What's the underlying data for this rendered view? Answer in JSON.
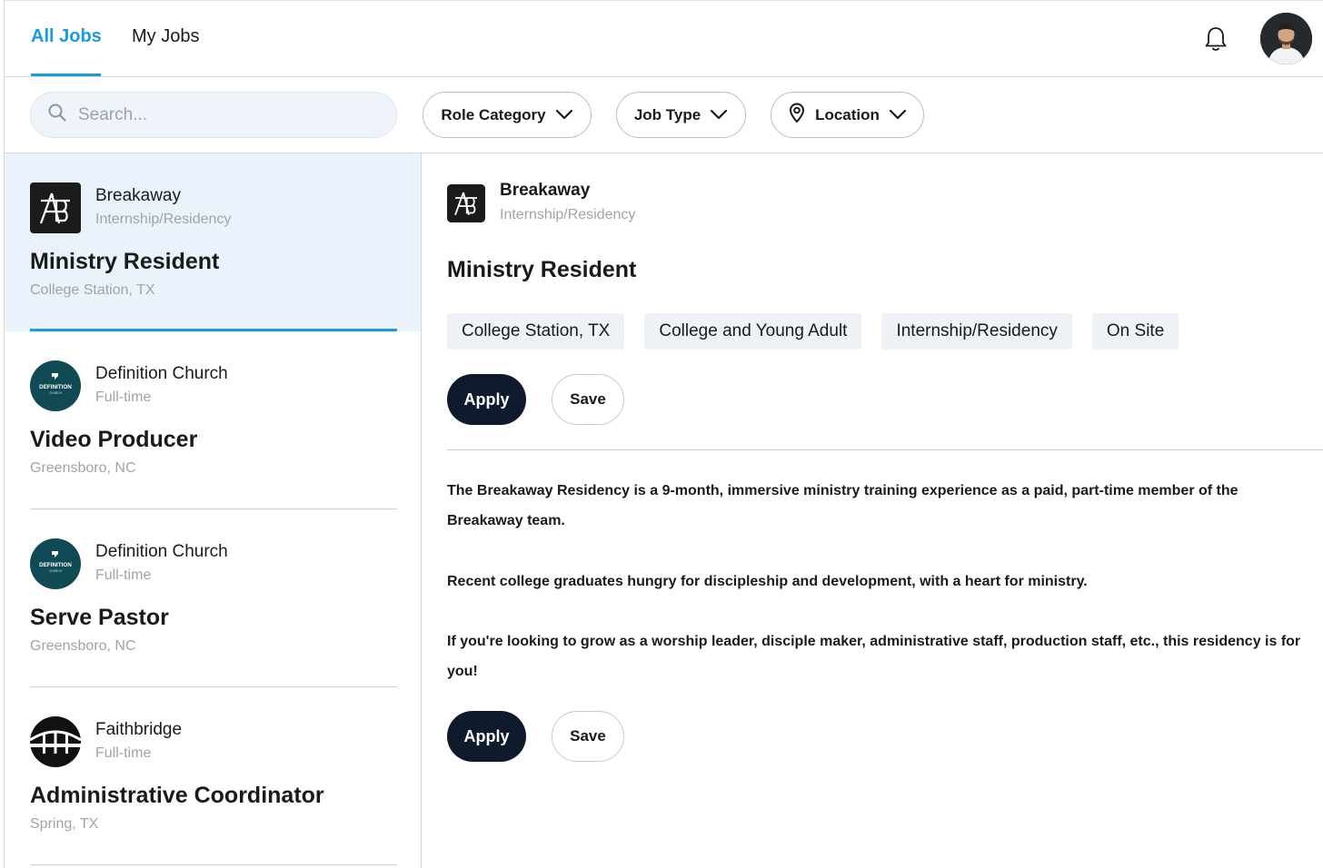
{
  "nav": {
    "tabs": [
      {
        "label": "All Jobs",
        "active": true
      },
      {
        "label": "My Jobs",
        "active": false
      }
    ],
    "accent_color": "#1a9be0"
  },
  "filters": {
    "search_placeholder": "Search...",
    "role_category": "Role Category",
    "job_type": "Job Type",
    "location": "Location"
  },
  "jobs": [
    {
      "org": "Breakaway",
      "kind": "Internship/Residency",
      "title": "Ministry Resident",
      "location": "College Station, TX",
      "selected": true,
      "logo": "breakaway-logo"
    },
    {
      "org": "Definition Church",
      "kind": "Full-time",
      "title": "Video Producer",
      "location": "Greensboro, NC",
      "logo": "definition-church-logo"
    },
    {
      "org": "Definition Church",
      "kind": "Full-time",
      "title": "Serve Pastor",
      "location": "Greensboro, NC",
      "logo": "definition-church-logo"
    },
    {
      "org": "Faithbridge",
      "kind": "Full-time",
      "title": "Administrative Coordinator",
      "location": "Spring, TX",
      "logo": "faithbridge-logo"
    }
  ],
  "detail": {
    "org": "Breakaway",
    "kind": "Internship/Residency",
    "title": "Ministry Resident",
    "tags": [
      "College Station, TX",
      "College and Young Adult",
      "Internship/Residency",
      "On Site"
    ],
    "apply_label": "Apply",
    "save_label": "Save",
    "description": [
      "The Breakaway Residency is a 9-month, immersive ministry training experience as a paid, part-time member of the Breakaway team.",
      "Recent college graduates hungry for discipleship and development, with a heart for ministry.",
      "If you're looking to grow as a worship leader, disciple maker, administrative staff, production staff, etc., this residency is for you!"
    ]
  },
  "logo_text": {
    "definition": "DEFINITION",
    "definition_sub": "CHURCH"
  }
}
